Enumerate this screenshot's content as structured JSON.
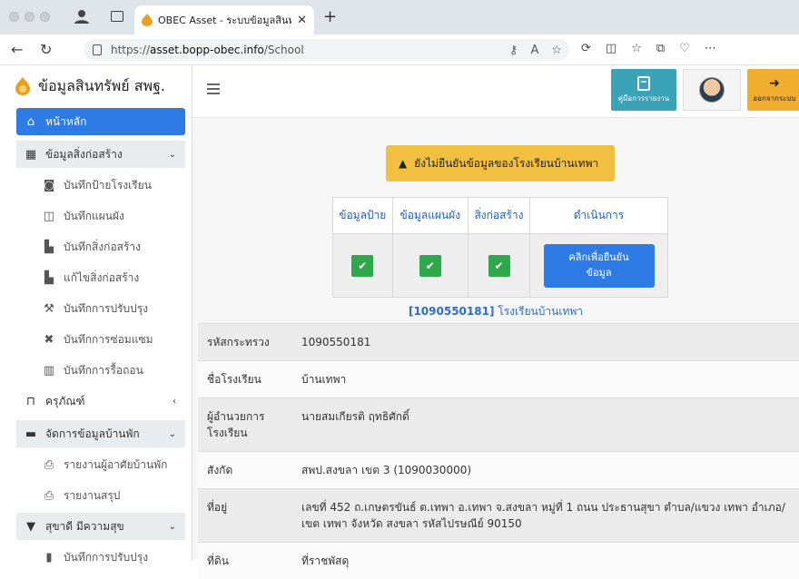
{
  "browser": {
    "tab_title": "OBEC Asset - ระบบข้อมูลสินทรัพ",
    "url_prefix": "https://",
    "url_host": "asset.bopp-obec.info",
    "url_path": "/School"
  },
  "sidebar": {
    "brand": "ข้อมูลสินทรัพย์ สพฐ.",
    "items": [
      {
        "label": "หน้าหลัก",
        "icon": "home-icon"
      },
      {
        "label": "ข้อมูลสิ่งก่อสร้าง",
        "icon": "building-icon"
      },
      {
        "label": "บันทึกป้ายโรงเรียน",
        "icon": "camera-icon"
      },
      {
        "label": "บันทึกแผนผัง",
        "icon": "map-icon"
      },
      {
        "label": "บันทึกสิ่งก่อสร้าง",
        "icon": "industry-icon"
      },
      {
        "label": "แก้ไขสิ่งก่อสร้าง",
        "icon": "industry-icon"
      },
      {
        "label": "บันทึกการปรับปรุง",
        "icon": "hammer-icon"
      },
      {
        "label": "บันทึกการซ่อมแซม",
        "icon": "tools-icon"
      },
      {
        "label": "บันทึกการรื้อถอน",
        "icon": "trash-icon"
      },
      {
        "label": "ครุภัณฑ์",
        "icon": "chair-icon"
      },
      {
        "label": "จัดการข้อมูลบ้านพัก",
        "icon": "bed-icon"
      },
      {
        "label": "รายงานผู้อาศัยบ้านพัก",
        "icon": "print-icon"
      },
      {
        "label": "รายงานสรุป",
        "icon": "print-icon"
      },
      {
        "label": "สุขาดี มีความสุข",
        "icon": "toilet-icon"
      },
      {
        "label": "บันทึกการปรับปรุง",
        "icon": "wrench-icon"
      }
    ]
  },
  "topbar": {
    "manual_label": "คู่มือการรายงาน",
    "logout_label": "ออกจากระบบ"
  },
  "alert": {
    "text": "ยังไม่ยืนยันข้อมูลของโรงเรียนบ้านเทพา"
  },
  "status_table": {
    "headers": [
      "ข้อมูลป้าย",
      "ข้อมูลแผนผัง",
      "สิ่งก่อสร้าง",
      "ดำเนินการ"
    ],
    "confirm_line1": "คลิกเพื่อยืนยัน",
    "confirm_line2": "ข้อมูล"
  },
  "school": {
    "code_bracket": "[1090550181]",
    "name_caption": "โรงเรียนบ้านเทพา"
  },
  "info": [
    {
      "key": "รหัสกระทรวง",
      "value": "1090550181"
    },
    {
      "key": "ชื่อโรงเรียน",
      "value": "บ้านเทพา"
    },
    {
      "key": "ผู้อำนวยการโรงเรียน",
      "value": "นายสมเกียรติ ฤทธิศักดิ์"
    },
    {
      "key": "สังกัด",
      "value": "สพป.สงขลา เขต 3 (1090030000)"
    },
    {
      "key": "ที่อยู่",
      "value": "เลขที่ 452 ถ.เกษตรขันธ์ ต.เทพา อ.เทพา จ.สงขลา หมู่ที่ 1 ถนน ประธานสุขา ตำบล/แขวง เทพา อำเภอ/เขต เทพา จังหวัด สงขลา รหัสไปรษณีย์ 90150"
    },
    {
      "key": "ที่ดิน",
      "value": "ที่ราชพัสดุ"
    }
  ],
  "colors": {
    "primary": "#2f7be6",
    "warning": "#f2c040",
    "success": "#2ea84a",
    "info": "#3aa3b7"
  }
}
